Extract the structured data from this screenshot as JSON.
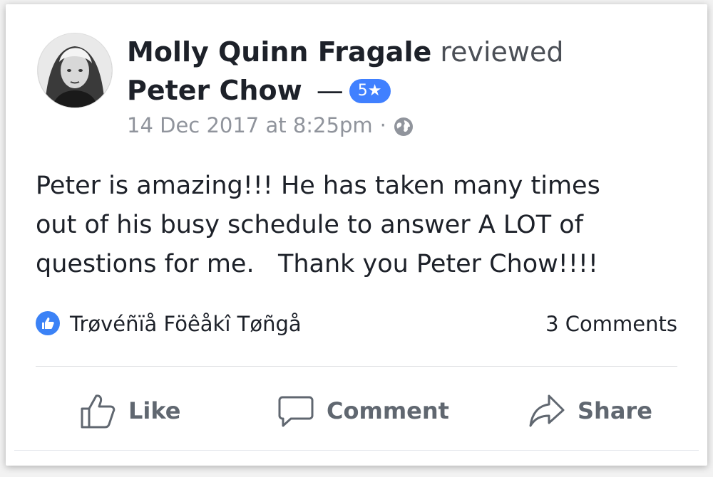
{
  "post": {
    "author": "Molly Quinn Fragale",
    "verb": "reviewed",
    "subject": "Peter Chow",
    "dash": "—",
    "rating_badge": "5★",
    "timestamp": "14 Dec 2017 at 8:25pm",
    "separator": "·",
    "privacy_icon": "globe-icon",
    "text": "Peter is amazing!!! He has taken many times\nout of his busy schedule to answer A LOT of\nquestions for me.   Thank you Peter Chow!!!!"
  },
  "reactions": {
    "icon": "like-icon",
    "reactor": "Trøvéñïå Föêåkî Tøñgå",
    "comments": "3 Comments"
  },
  "actions": {
    "like": "Like",
    "comment": "Comment",
    "share": "Share"
  },
  "colors": {
    "accent": "#4080ff",
    "text": "#1d2129",
    "muted": "#90949c",
    "action": "#606770"
  }
}
